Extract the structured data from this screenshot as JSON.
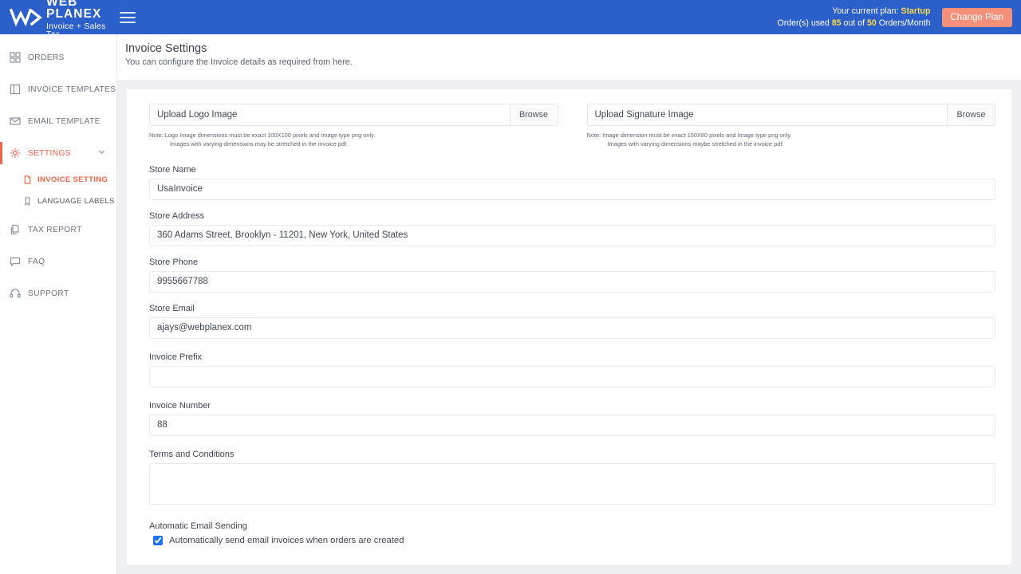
{
  "topbar": {
    "brand_name": "WEB PLANEX",
    "brand_sub": "Invoice + Sales Tax",
    "menu_icon": "hamburger-icon",
    "plan_prefix": "Your current plan:",
    "plan_name": "Startup",
    "orders_prefix": "Order(s) used",
    "orders_used": "85",
    "orders_mid": "out of",
    "orders_limit": "50",
    "orders_suffix": "Orders/Month",
    "change_plan_label": "Change Plan",
    "bg_color": "#2b5fc9",
    "accent_color": "#ffd84d",
    "button_color": "#f4907a"
  },
  "sidebar": {
    "items": [
      {
        "label": "ORDERS",
        "icon": "grid-icon",
        "active": false
      },
      {
        "label": "INVOICE TEMPLATES",
        "icon": "document-icon",
        "active": false
      },
      {
        "label": "EMAIL TEMPLATE",
        "icon": "envelope-icon",
        "active": false
      },
      {
        "label": "SETTINGS",
        "icon": "gear-icon",
        "active": true
      },
      {
        "label": "TAX REPORT",
        "icon": "copy-files-icon",
        "active": false
      },
      {
        "label": "FAQ",
        "icon": "chat-bubble-icon",
        "active": false
      },
      {
        "label": "SUPPORT",
        "icon": "headset-icon",
        "active": false
      }
    ],
    "sub_items": [
      {
        "label": "INVOICE SETTING",
        "icon": "file-icon",
        "active": true
      },
      {
        "label": "LANGUAGE LABELS",
        "icon": "bookmark-icon",
        "active": false
      }
    ],
    "active_color": "#f06449"
  },
  "page": {
    "title": "Invoice Settings",
    "subtitle": "You can configure the Invoice details as required from here."
  },
  "uploads": [
    {
      "label": "Upload Logo Image",
      "browse_label": "Browse",
      "note_line1": "Note: Logo Image dimensions must be exact 100X100 pixels and Image type png only.",
      "note_line2": "Images with varying dimensions may be stretched in the invoice pdf."
    },
    {
      "label": "Upload Signature Image",
      "browse_label": "Browse",
      "note_line1": "Note: Image dimension must be exact 150X80 pixels and Image type png only.",
      "note_line2": "Images with varying dimensions maybe stretched in the invoice pdf."
    }
  ],
  "fields": [
    {
      "label": "Store Name",
      "value": "UsaInvoice",
      "placeholder": ""
    },
    {
      "label": "Store Address",
      "value": "360 Adams Street, Brooklyn - 11201, New York, United States",
      "placeholder": ""
    },
    {
      "label": "Store Phone",
      "value": "9955667788",
      "placeholder": ""
    },
    {
      "label": "Store Email",
      "value": "ajays@webplanex.com",
      "placeholder": ""
    },
    {
      "label": "Invoice Prefix",
      "value": "",
      "placeholder": ""
    },
    {
      "label": "Invoice Number",
      "value": "88",
      "placeholder": ""
    }
  ],
  "terms": {
    "label": "Terms and Conditions",
    "value": "",
    "placeholder": ""
  },
  "automatic_email": {
    "label": "Automatic Email Sending",
    "checkbox_label": "Automatically send email invoices when orders are created",
    "checked": true
  }
}
